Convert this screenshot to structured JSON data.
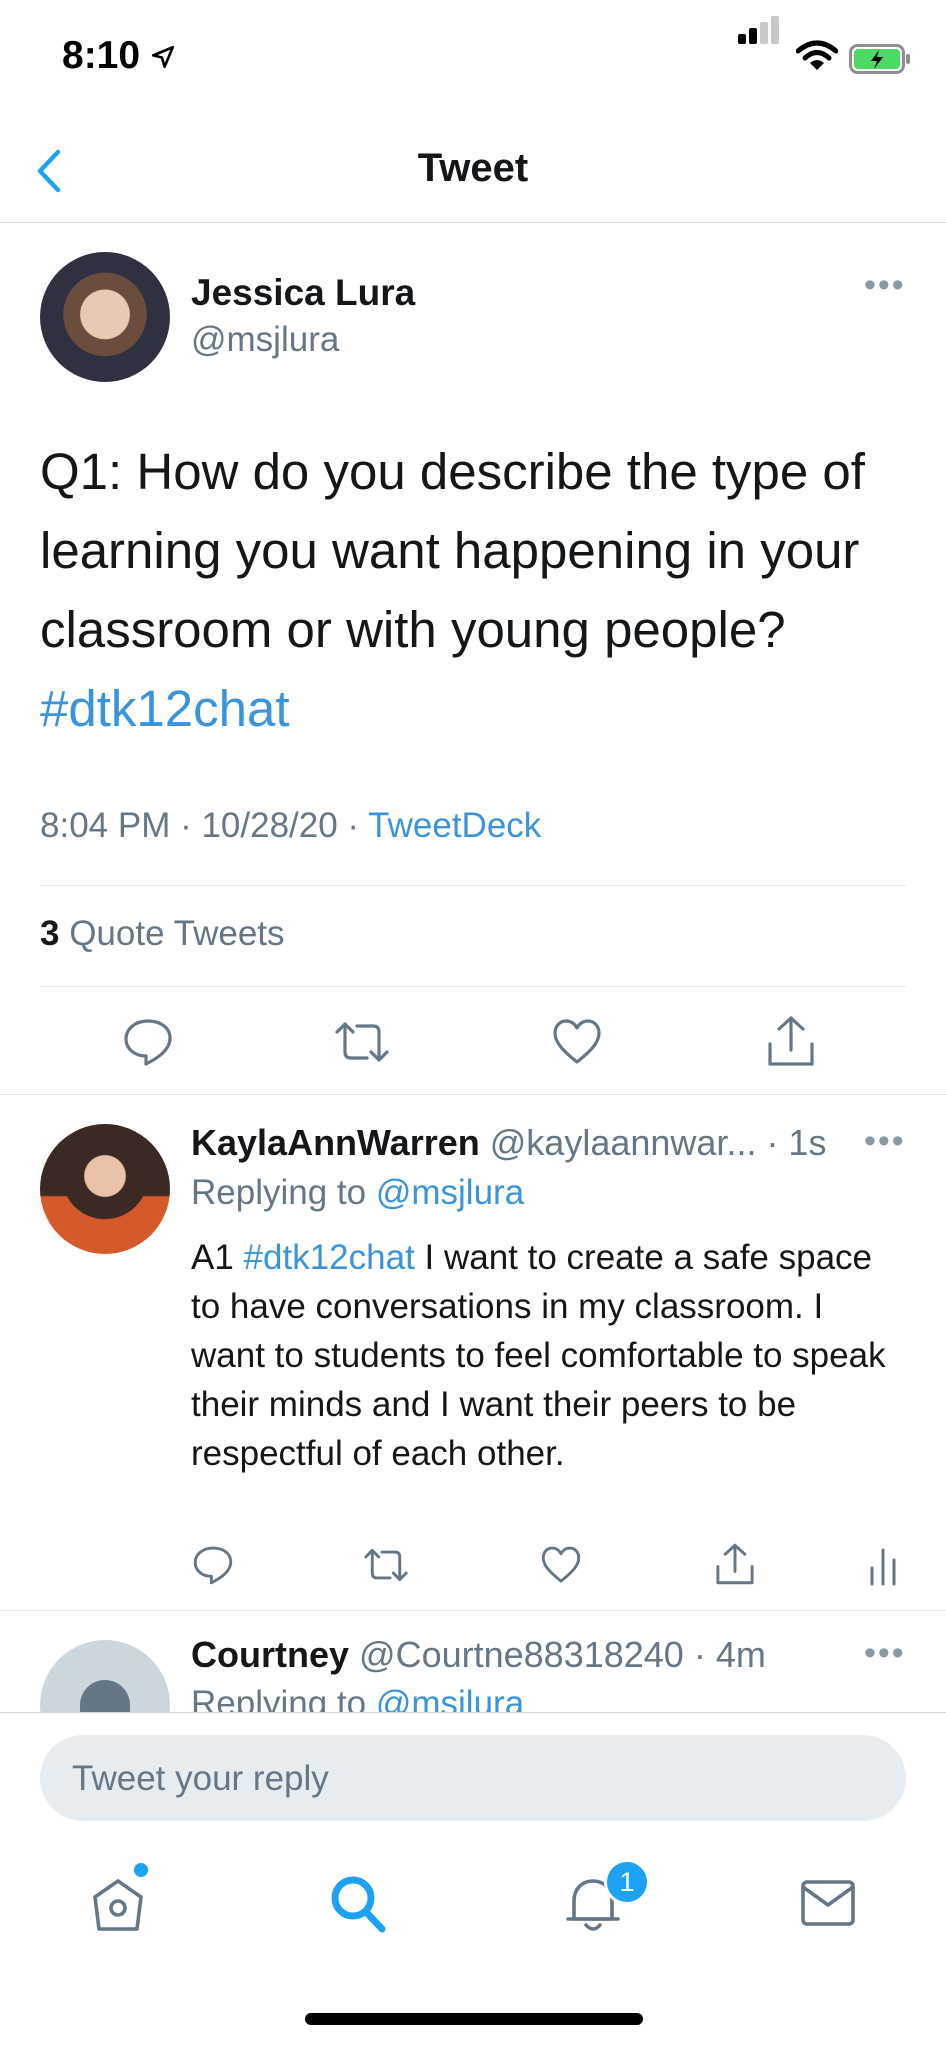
{
  "status_bar": {
    "time": "8:10"
  },
  "nav": {
    "title": "Tweet"
  },
  "main_tweet": {
    "name": "Jessica Lura",
    "handle": "@msjlura",
    "text": "Q1: How do you describe the type of learning you want happening in your classroom or with young people?",
    "hashtag": "#dtk12chat",
    "meta": "8:04 PM · 10/28/20 · ",
    "source": "TweetDeck",
    "quote_count": "3",
    "quote_label": "Quote Tweets"
  },
  "replies": [
    {
      "name": "KaylaAnnWarren",
      "handle_time": "@kaylaannwar... · 1s",
      "replying_prefix": "Replying to",
      "replying_to": "@msjlura",
      "text_prefix": "A1",
      "hashtag": "#dtk12chat",
      "text": "I want to create a safe space to have conversations in my classroom. I want to students to feel comfortable to speak their minds and I want their peers to be respectful of each other."
    },
    {
      "name": "Courtney",
      "handle_time": "@Courtne88318240 · 4m",
      "replying_prefix": "Replying to",
      "replying_to": "@msjlura"
    }
  ],
  "composer": {
    "placeholder": "Tweet your reply"
  },
  "tab_bar": {
    "notification_count": "1"
  },
  "colors": {
    "accent": "#1da1f2",
    "link": "#3b94d9",
    "muted": "#657786"
  },
  "icons": [
    "location-arrow-icon",
    "signal-icon",
    "wifi-icon",
    "battery-icon",
    "back-chevron-icon",
    "more-icon",
    "reply-icon",
    "retweet-icon",
    "like-icon",
    "share-icon",
    "stats-icon",
    "home-icon",
    "search-icon",
    "notifications-icon",
    "messages-icon"
  ]
}
